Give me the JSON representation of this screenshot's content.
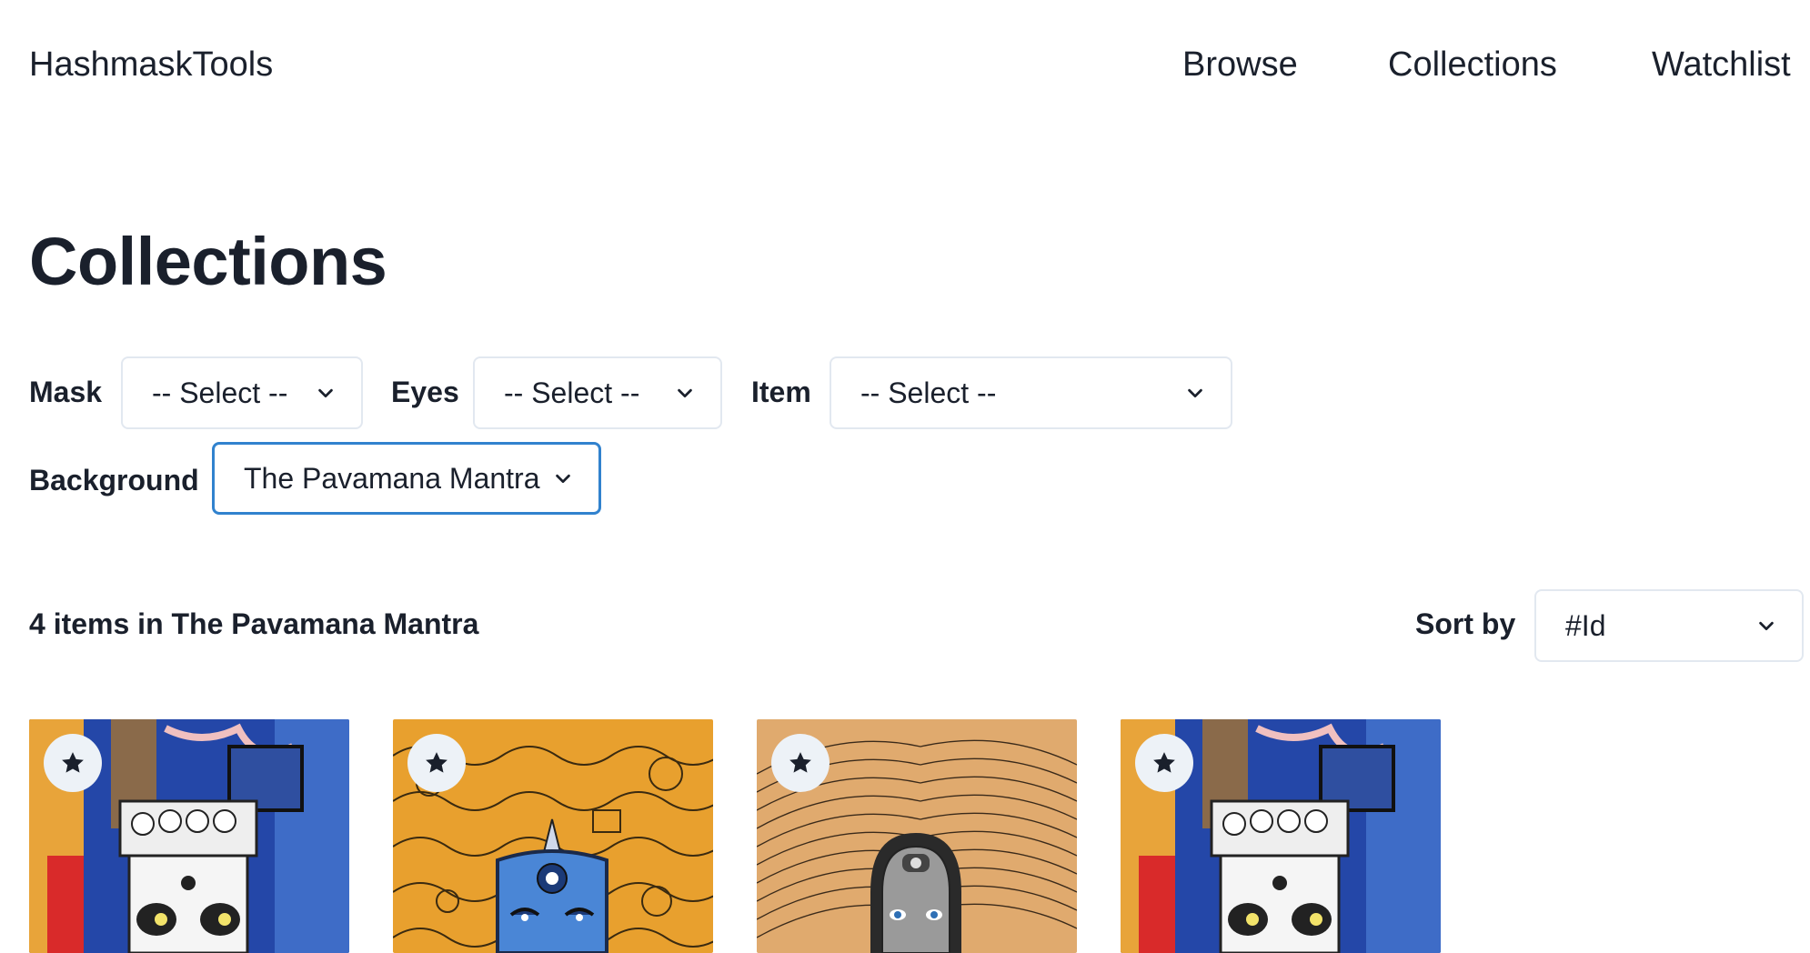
{
  "header": {
    "brand": "HashmaskTools",
    "nav": {
      "browse": "Browse",
      "collections": "Collections",
      "watchlist": "Watchlist"
    }
  },
  "page": {
    "title": "Collections"
  },
  "filters": {
    "mask": {
      "label": "Mask",
      "value": "-- Select --"
    },
    "eyes": {
      "label": "Eyes",
      "value": "-- Select --"
    },
    "item": {
      "label": "Item",
      "value": "-- Select --"
    },
    "background": {
      "label": "Background",
      "value": "The Pavamana Mantra"
    }
  },
  "results": {
    "summary": "4 items in The Pavamana Mantra",
    "sort_label": "Sort by",
    "sort_value": "#Id"
  },
  "colors": {
    "text": "#1a202c",
    "border": "#e2e8f0",
    "focus": "#3182ce",
    "star_bg": "#edf2f7"
  },
  "cards": [
    {
      "icon": "star-icon",
      "artwork": "masked-figure-white-crown"
    },
    {
      "icon": "star-icon",
      "artwork": "masked-figure-blue-face"
    },
    {
      "icon": "star-icon",
      "artwork": "masked-figure-grey-face"
    },
    {
      "icon": "star-icon",
      "artwork": "masked-figure-white-crown"
    }
  ]
}
